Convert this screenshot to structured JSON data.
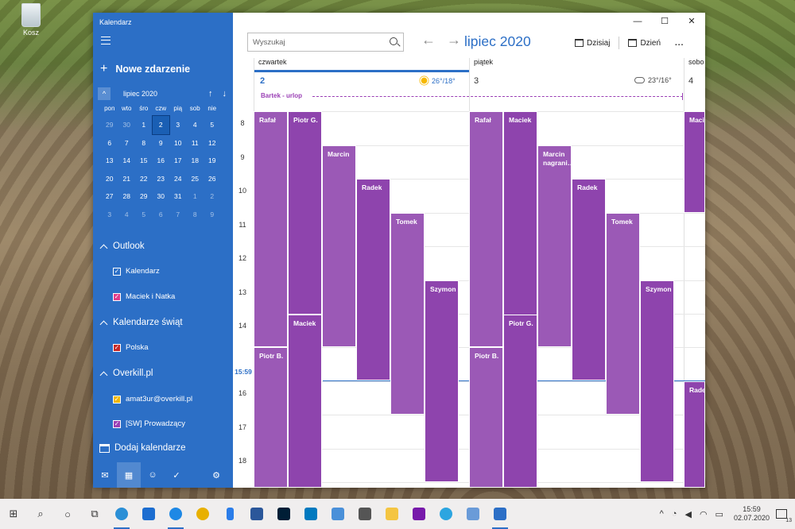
{
  "desktop": {
    "recycle_bin_label": "Kosz"
  },
  "app": {
    "title": "Kalendarz"
  },
  "sidebar": {
    "new_event_label": "Nowe zdarzenie",
    "mini_calendar": {
      "month_label": "lipiec 2020",
      "weekdays": [
        "pon",
        "wto",
        "śro",
        "czw",
        "pią",
        "sob",
        "nie"
      ],
      "weeks": [
        [
          "29",
          "30",
          "1",
          "2",
          "3",
          "4",
          "5"
        ],
        [
          "6",
          "7",
          "8",
          "9",
          "10",
          "11",
          "12"
        ],
        [
          "13",
          "14",
          "15",
          "16",
          "17",
          "18",
          "19"
        ],
        [
          "20",
          "21",
          "22",
          "23",
          "24",
          "25",
          "26"
        ],
        [
          "27",
          "28",
          "29",
          "30",
          "31",
          "1",
          "2"
        ],
        [
          "3",
          "4",
          "5",
          "6",
          "7",
          "8",
          "9"
        ]
      ],
      "selected_day": "2"
    },
    "groups": [
      {
        "name": "Outlook",
        "calendars": [
          {
            "name": "Kalendarz",
            "color": "#2c6fc6"
          },
          {
            "name": "Maciek i Natka",
            "color": "#e03c8a"
          }
        ]
      },
      {
        "name": "Kalendarze świąt",
        "calendars": [
          {
            "name": "Polska",
            "color": "#c62828"
          }
        ]
      },
      {
        "name": "Overkill.pl",
        "calendars": [
          {
            "name": "amat3ur@overkill.pl",
            "color": "#f2b705"
          },
          {
            "name": "[SW] Prowadzący",
            "color": "#9a3fb5"
          }
        ]
      }
    ],
    "add_calendars_label": "Dodaj kalendarze",
    "bottom_icons": [
      "mail-icon",
      "calendar-icon",
      "people-icon",
      "todo-icon",
      "settings-icon"
    ]
  },
  "main": {
    "search_placeholder": "Wyszukaj",
    "month_title": "lipiec 2020",
    "today_label": "Dzisiaj",
    "view_label": "Dzień",
    "more_label": "...",
    "days": [
      {
        "header": "czwartek",
        "number": "2",
        "weather": "26°/18°",
        "weather_icon": "sun-icon"
      },
      {
        "header": "piątek",
        "number": "3",
        "weather": "23°/16°",
        "weather_icon": "partly-cloudy-icon"
      },
      {
        "header": "sobo",
        "number": "4",
        "weather": ""
      }
    ],
    "all_day_event": "Bartek - urlop",
    "hours": [
      "8",
      "9",
      "10",
      "11",
      "12",
      "13",
      "14",
      "16",
      "17",
      "18"
    ],
    "now_time": "15:59",
    "event_color_light": "#9b59b6",
    "event_color_dark": "#8e44ad",
    "events": [
      {
        "title": "Rafał"
      },
      {
        "title": "Piotr G."
      },
      {
        "title": "Marcin"
      },
      {
        "title": "Radek"
      },
      {
        "title": "Tomek"
      },
      {
        "title": "Szymon"
      },
      {
        "title": "Maciek"
      },
      {
        "title": "Piotr B."
      },
      {
        "title": "Rafał"
      },
      {
        "title": "Maciek"
      },
      {
        "title": "Marcin nagrani…"
      },
      {
        "title": "Radek"
      },
      {
        "title": "Tomek"
      },
      {
        "title": "Szymon"
      },
      {
        "title": "Piotr G."
      },
      {
        "title": "Piotr B."
      },
      {
        "title": "Macie"
      },
      {
        "title": "Rade"
      }
    ]
  },
  "taskbar": {
    "clock_time": "15:59",
    "clock_date": "02.07.2020",
    "notification_count": "13"
  }
}
